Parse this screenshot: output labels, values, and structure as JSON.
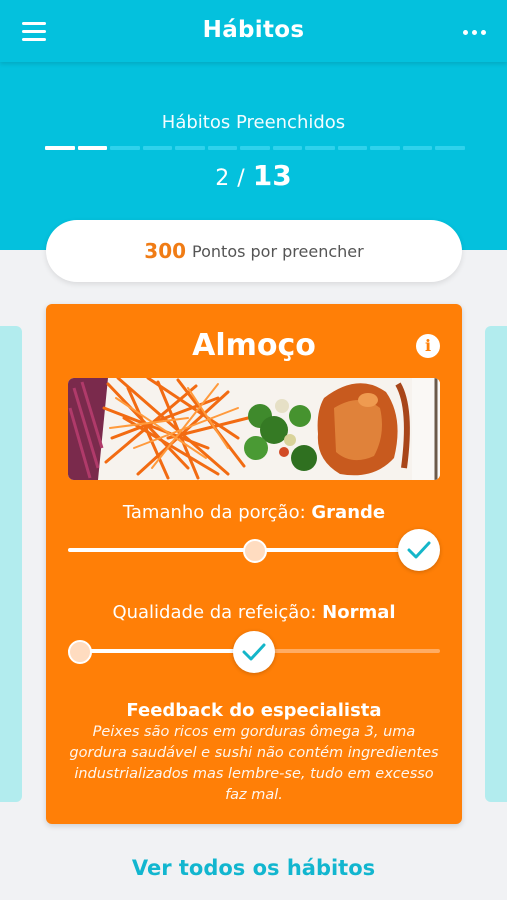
{
  "appbar": {
    "title": "Hábitos",
    "menu_icon": "hamburger-menu-icon",
    "more_icon": "more-dots-icon"
  },
  "progress": {
    "label": "Hábitos Preenchidos",
    "completed": "2",
    "separator": "/",
    "total": "13",
    "completed_count": 2,
    "total_count": 13
  },
  "points": {
    "value": "300",
    "text": "Pontos por preencher"
  },
  "card": {
    "title": "Almoço",
    "info_icon": "info-icon",
    "image": "meal-photo",
    "portion": {
      "label": "Tamanho da porção:",
      "value": "Grande",
      "level": 1.0
    },
    "quality": {
      "label": "Qualidade da refeição:",
      "value": "Normal",
      "level": 0.5
    },
    "feedback_title": "Feedback do especialista",
    "feedback_text": "Peixes são ricos em gorduras ômega 3, uma gordura saudável e sushi não contém ingredientes industrializados mas lembre-se, tudo em excesso faz mal."
  },
  "view_all_label": "Ver todos os hábitos",
  "colors": {
    "primary": "#04c1dd",
    "card": "#ff7f07",
    "points": "#f07c15",
    "link": "#12b6cf"
  }
}
